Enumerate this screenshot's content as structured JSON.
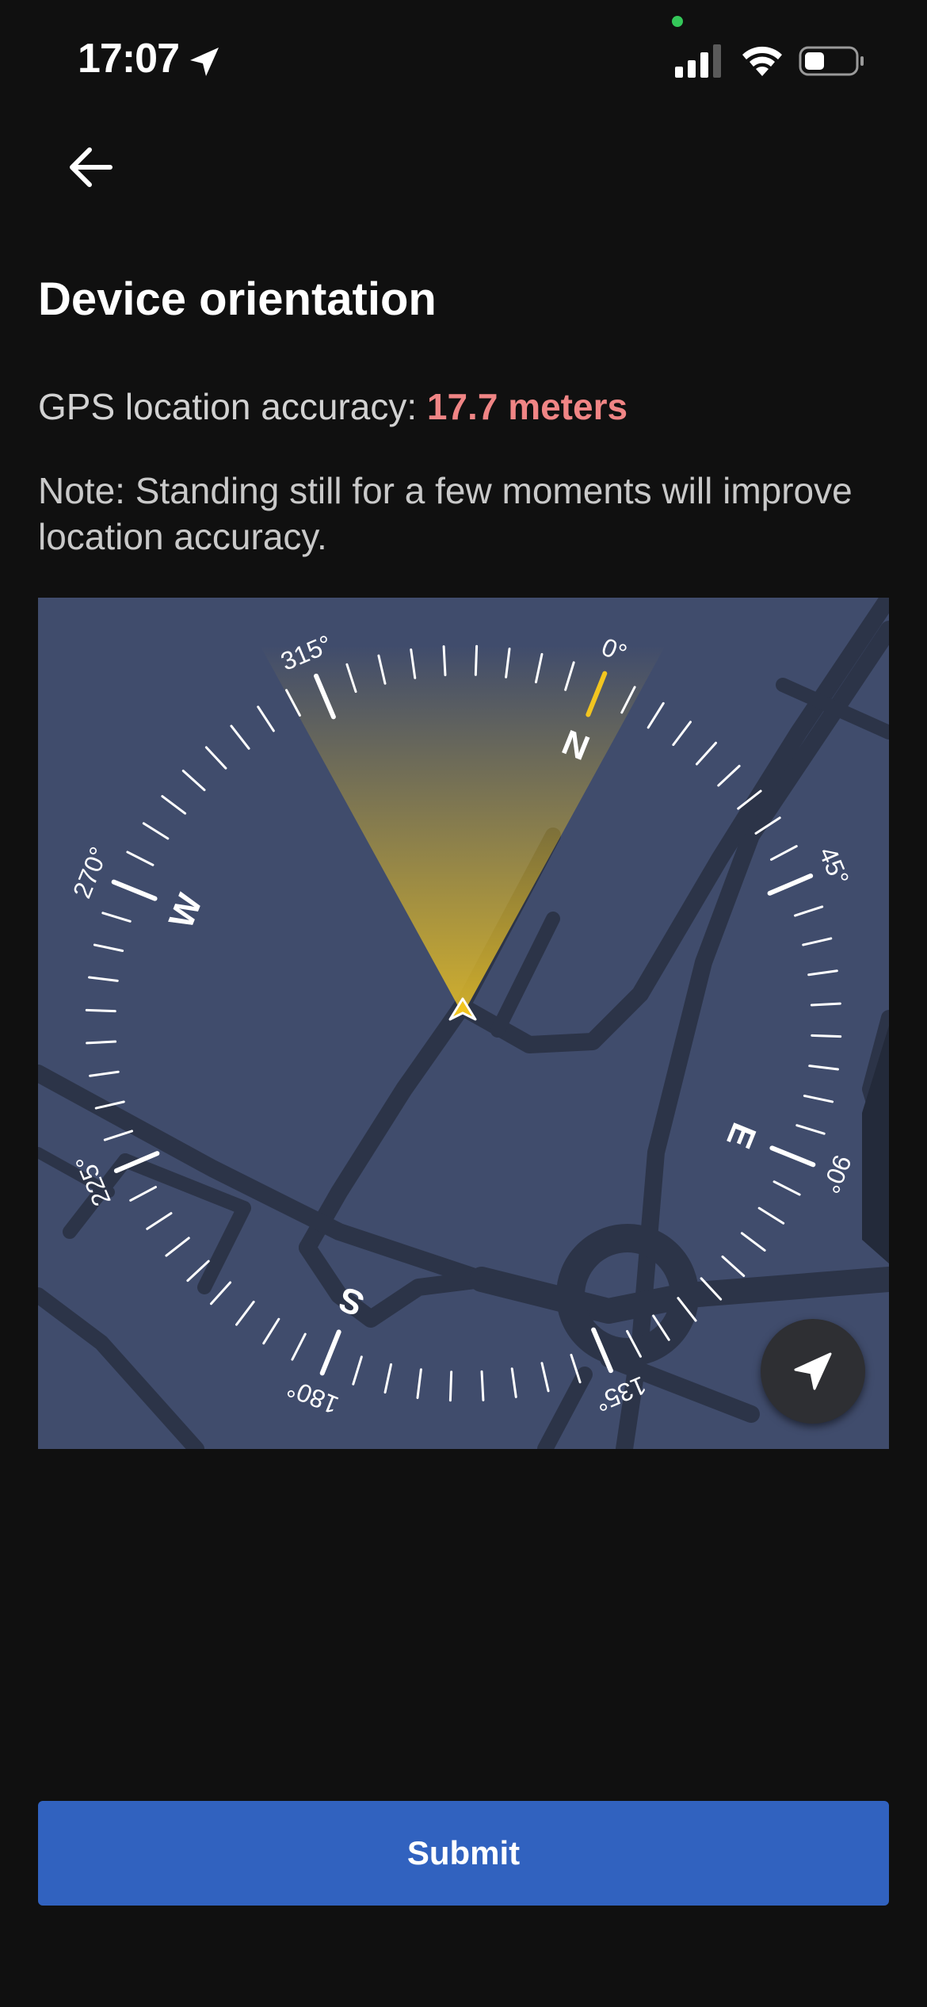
{
  "status_bar": {
    "time": "17:07",
    "icons": [
      "location-arrow-icon",
      "cellular-signal-icon",
      "wifi-icon",
      "battery-icon"
    ],
    "privacy_indicator_color": "#34c759"
  },
  "header": {
    "back_icon": "arrow-left-icon",
    "title": "Device orientation"
  },
  "gps": {
    "accuracy_label": "GPS location accuracy: ",
    "accuracy_value": "17.7 meters",
    "accuracy_color": "#f08585"
  },
  "note": "Note: Standing still for a few moments will improve location accuracy.",
  "compass": {
    "cardinals": [
      {
        "label": "N",
        "bearing": 0
      },
      {
        "label": "E",
        "bearing": 90
      },
      {
        "label": "S",
        "bearing": 180
      },
      {
        "label": "W",
        "bearing": 270
      }
    ],
    "degree_labels": [
      {
        "label": "0°",
        "bearing": 0
      },
      {
        "label": "45°",
        "bearing": 45
      },
      {
        "label": "90°",
        "bearing": 90
      },
      {
        "label": "135°",
        "bearing": 135
      },
      {
        "label": "180°",
        "bearing": 180
      },
      {
        "label": "225°",
        "bearing": 225
      },
      {
        "label": "270°",
        "bearing": 270
      },
      {
        "label": "315°",
        "bearing": 315
      }
    ],
    "rotation_deg": 22,
    "tick_step_deg": 5,
    "heading_fov_deg": 60,
    "heading_color": "#d8b42a",
    "north_tick_color": "#f2c520",
    "map_background": "#404c6c",
    "road_color": "#2c3448"
  },
  "recenter": {
    "icon": "navigation-arrow-icon"
  },
  "submit": {
    "label": "Submit",
    "color": "#3162bf"
  }
}
